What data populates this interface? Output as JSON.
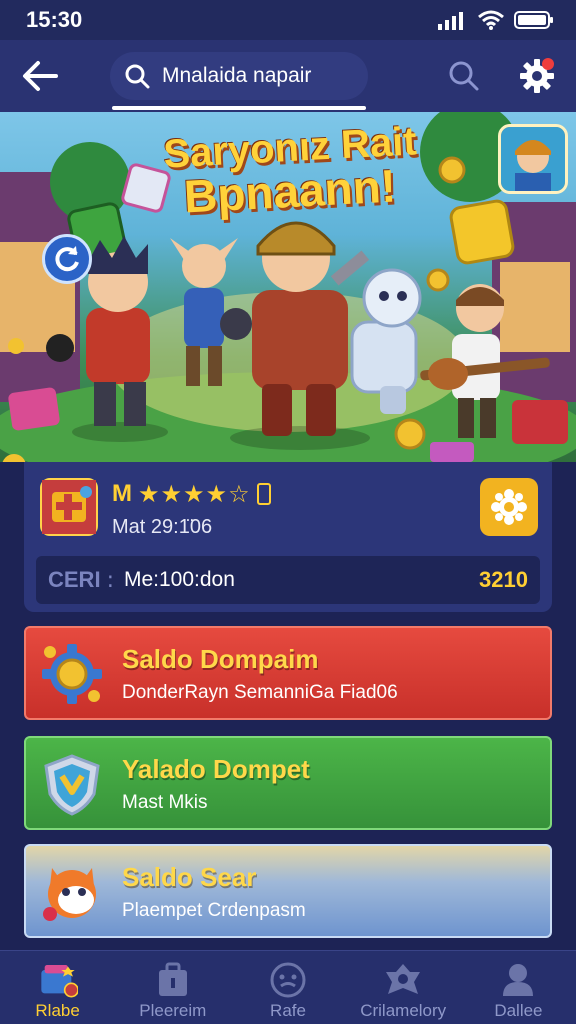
{
  "status_bar": {
    "time": "15:30"
  },
  "header": {
    "search_value": "Mnalaida napair"
  },
  "banner": {
    "title_line1": "Saryonız Rait",
    "title_line2": "Bpnaann!"
  },
  "info_card": {
    "rating_letter": "M",
    "rating_stars": "★★★★☆",
    "date": "Mat 29:1̈06",
    "stat_label": "CERI",
    "stat_separator": ":",
    "stat_value": "Me:100:don",
    "stat_number": "3210"
  },
  "actions": [
    {
      "title": "Saldo Dompaim",
      "subtitle": "DonderRayn SemanniGa Fiad06",
      "color": "#d83a33"
    },
    {
      "title": "Yalado Dompet",
      "subtitle": "Mast Mkis",
      "color": "#3fa63f"
    },
    {
      "title": "Saldo Sear",
      "subtitle": "Plaempet Crdenpasm",
      "color": "#8aa9d6"
    }
  ],
  "bottom_nav": [
    {
      "label": "Rlabe",
      "icon": "game-store-icon",
      "active": true
    },
    {
      "label": "Pleereim",
      "icon": "briefcase-icon",
      "active": false
    },
    {
      "label": "Rafe",
      "icon": "clock-icon",
      "active": false
    },
    {
      "label": "Crilamelory",
      "icon": "badge-icon",
      "active": false
    },
    {
      "label": "Dallee",
      "icon": "user-icon",
      "active": false
    }
  ],
  "colors": {
    "background": "#1d2355",
    "accent_gold": "#ffcf33",
    "card_red": "#d83a33",
    "card_green": "#3fa63f",
    "card_blue": "#8aa9d6"
  }
}
